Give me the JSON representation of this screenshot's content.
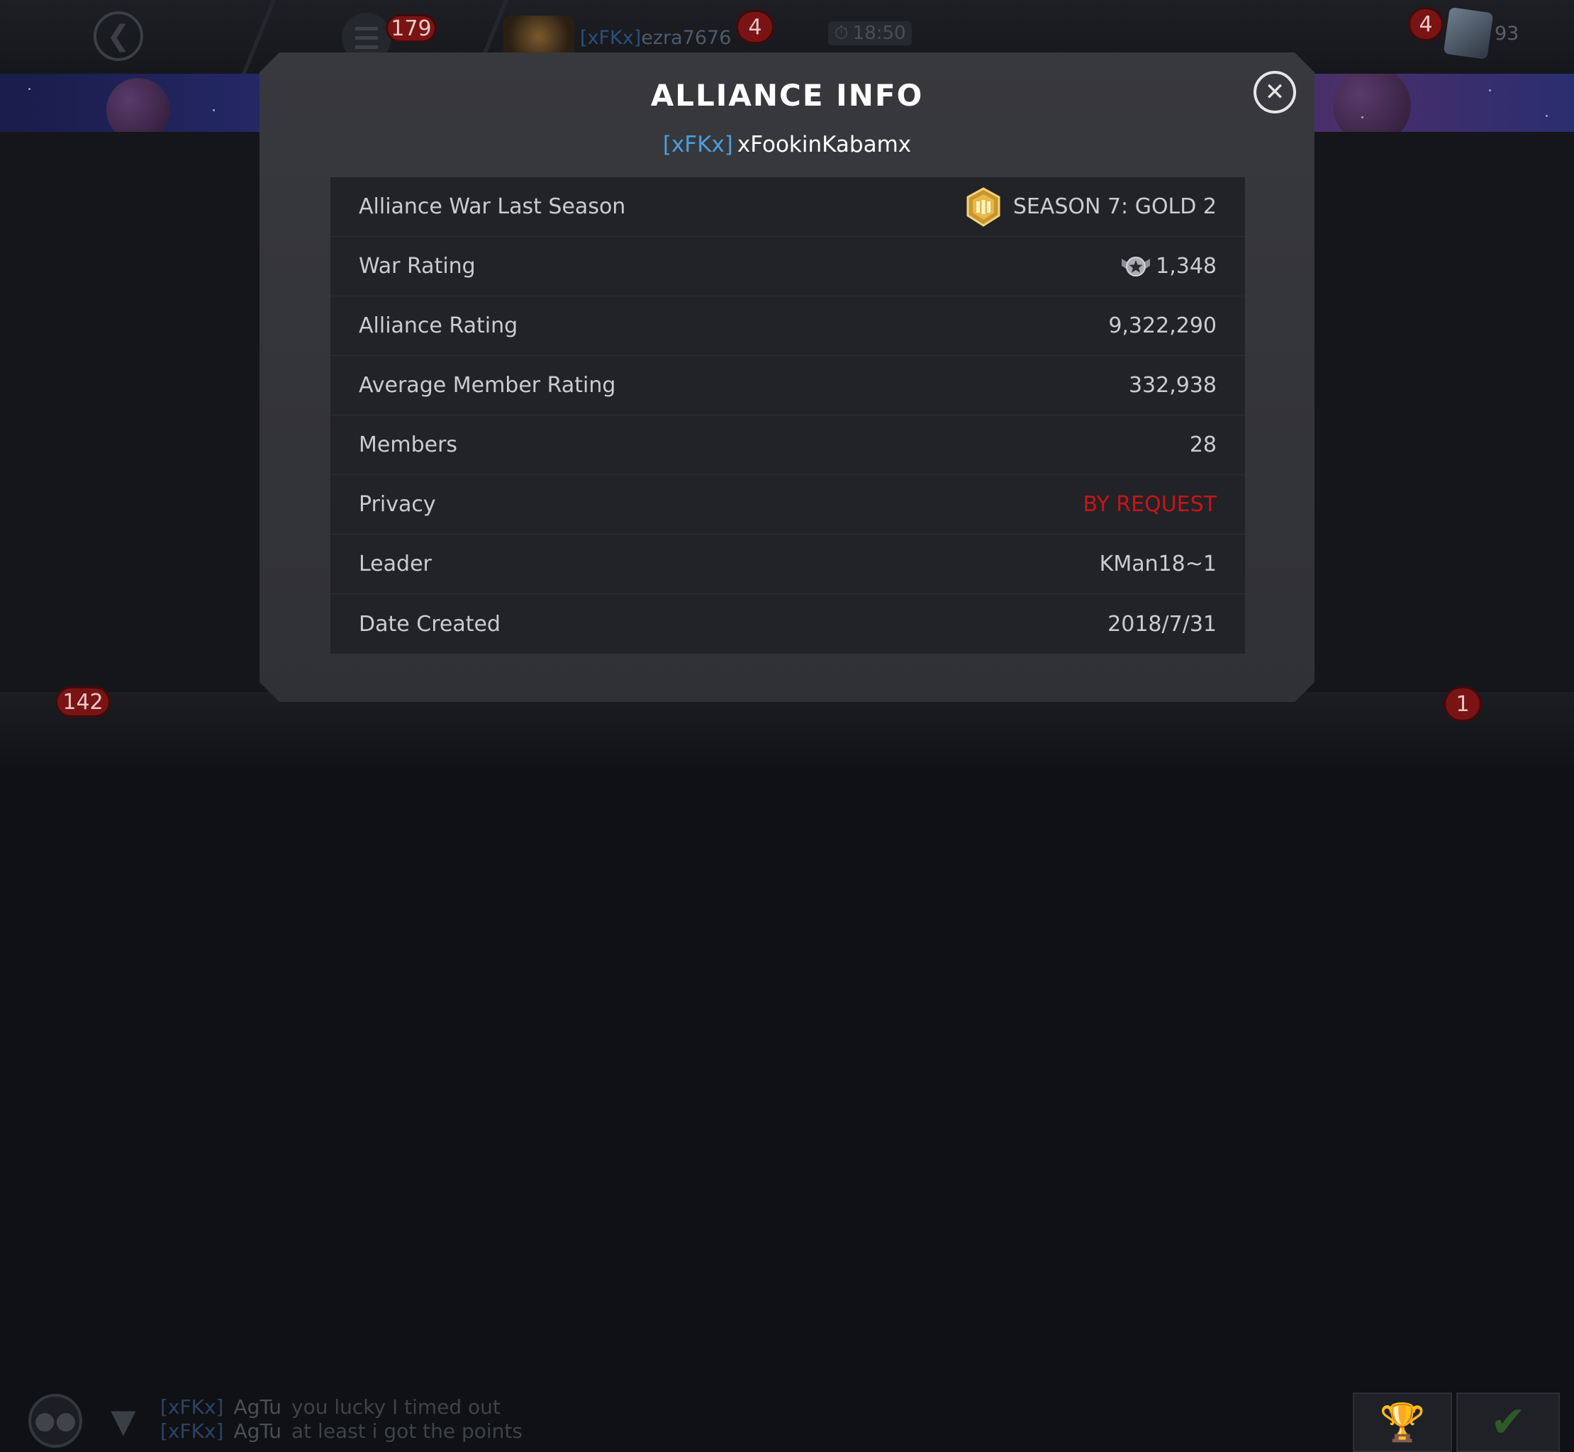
{
  "topbar": {
    "notification_count": "179",
    "player": {
      "alliance_tag": "[xFKx]",
      "name": "ezra7676"
    },
    "player_badge": "4",
    "timer": "18:50",
    "crystal_badge": "4",
    "crystal_count": "93"
  },
  "modal": {
    "title": "ALLIANCE INFO",
    "alliance_tag": "[xFKx]",
    "alliance_name": "xFookinKabamx",
    "rows": [
      {
        "label": "Alliance War Last Season",
        "value": "SEASON 7: GOLD 2",
        "icon": "gold-tier-badge-icon"
      },
      {
        "label": "War Rating",
        "value": "1,348",
        "icon": "war-rating-icon"
      },
      {
        "label": "Alliance Rating",
        "value": "9,322,290"
      },
      {
        "label": "Average Member Rating",
        "value": "332,938"
      },
      {
        "label": "Members",
        "value": "28"
      },
      {
        "label": "Privacy",
        "value": "BY REQUEST",
        "value_color": "#c8141a"
      },
      {
        "label": "Leader",
        "value": "KMan18~1"
      },
      {
        "label": "Date Created",
        "value": "2018/7/31"
      }
    ]
  },
  "bottombar": {
    "chat_count": "142",
    "chat": [
      {
        "tag": "[xFKx]",
        "user": "AgTu",
        "message": "you lucky I timed out"
      },
      {
        "tag": "[xFKx]",
        "user": "AgTu",
        "message": "at least i got the points"
      }
    ],
    "quest_badge": "1"
  },
  "colors": {
    "accent_blue": "#4a9ee0",
    "privacy_red": "#c8141a",
    "modal_bg": "#38393d",
    "table_bg": "#222326"
  }
}
